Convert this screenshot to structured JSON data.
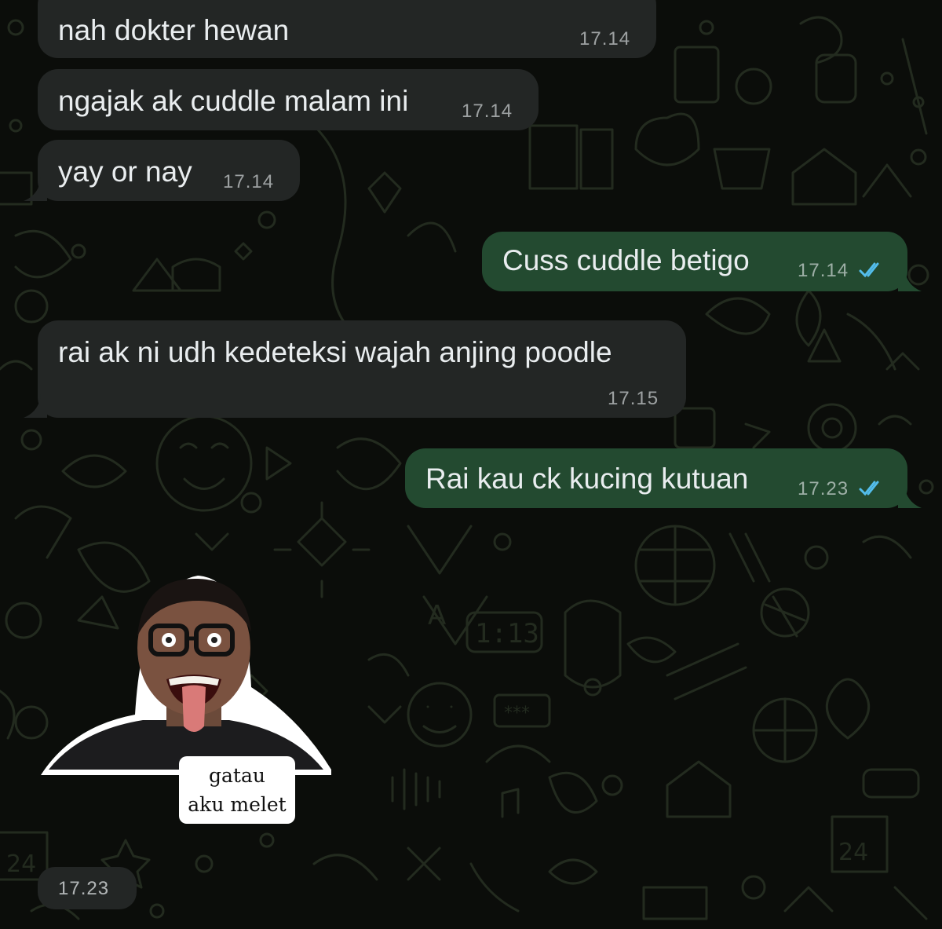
{
  "messages": [
    {
      "text": "nah dokter hewan",
      "time": "17.14",
      "direction": "incoming"
    },
    {
      "text": "ngajak ak cuddle malam ini",
      "time": "17.14",
      "direction": "incoming"
    },
    {
      "text": "yay or nay",
      "time": "17.14",
      "direction": "incoming"
    },
    {
      "text": "Cuss cuddle betigo",
      "time": "17.14",
      "direction": "outgoing",
      "status": "read"
    },
    {
      "text": "rai ak ni udh kedeteksi wajah anjing poodle",
      "time": "17.15",
      "direction": "incoming"
    },
    {
      "text": "Rai kau ck kucing kutuan",
      "time": "17.23",
      "direction": "outgoing",
      "status": "read"
    }
  ],
  "sticker": {
    "caption_line1": "gatau",
    "caption_line2": "aku melet",
    "time": "17.23"
  },
  "colors": {
    "background": "#0b0d0a",
    "incoming_bubble": "#232625",
    "outgoing_bubble": "#234a30",
    "read_ticks": "#53bdeb"
  }
}
